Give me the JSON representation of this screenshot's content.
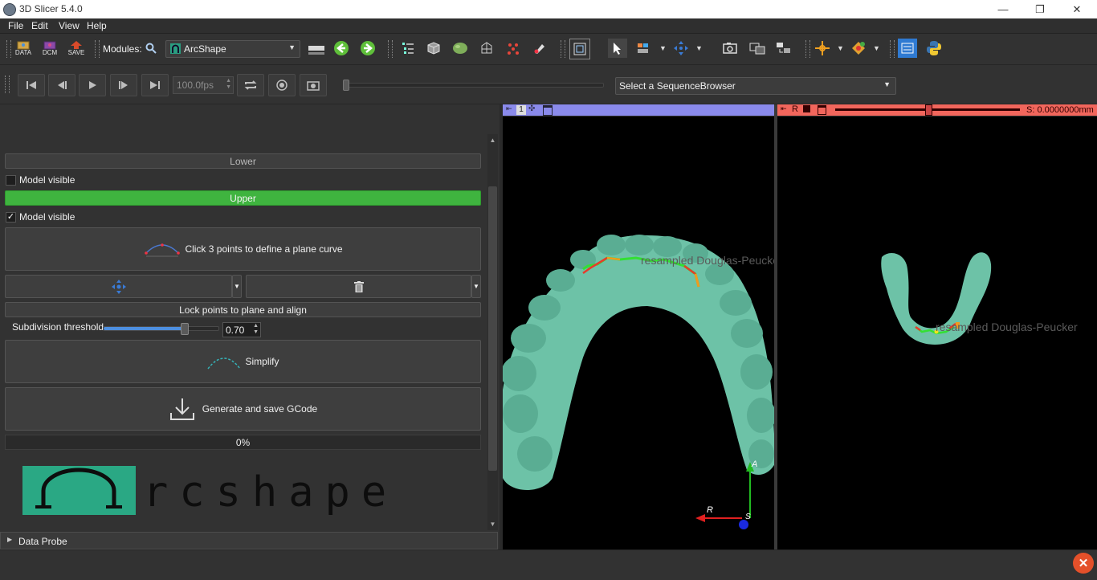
{
  "window": {
    "title": "3D Slicer 5.4.0",
    "minimize": "—",
    "restore": "❐",
    "close": "✕"
  },
  "menu": [
    "File",
    "Edit",
    "View",
    "Help"
  ],
  "toolbar": {
    "data_label": "DATA",
    "dcm_label": "DCM",
    "save_label": "SAVE",
    "modules_label": "Modules:",
    "module_selected": "ArcShape"
  },
  "sequence": {
    "fps": "100.0fps",
    "browser_placeholder": "Select a SequenceBrowser"
  },
  "panel": {
    "lower_button": "Lower",
    "lower_model_visible": "Model visible",
    "lower_model_checked": false,
    "upper_button": "Upper",
    "upper_model_visible": "Model visible",
    "upper_model_checked": true,
    "define_curve_button": "Click 3 points to define a plane curve",
    "lock_points_button": "Lock points to plane and align",
    "subdivision_label": "Subdivision threshold",
    "subdivision_value": "0.70",
    "subdivision_fraction": 0.7,
    "simplify_button": "Simplify",
    "gcode_button": "Generate and save GCode",
    "progress_text": "0%",
    "progress_value": 0,
    "logo_text": "rcshape",
    "data_probe": "Data Probe"
  },
  "views": {
    "view3d_number": "1",
    "red_label": "R",
    "red_offset": "S: 0.0000000mm",
    "overlay_text": "resampled Douglas-Peucker",
    "axis_A": "A",
    "axis_R": "R",
    "axis_S": "S"
  },
  "colors": {
    "view3d_bar": "#8a8aeb",
    "red_bar": "#f2665c",
    "upper_green": "#3fb43f",
    "tooth_green": "#6dc2a7"
  }
}
